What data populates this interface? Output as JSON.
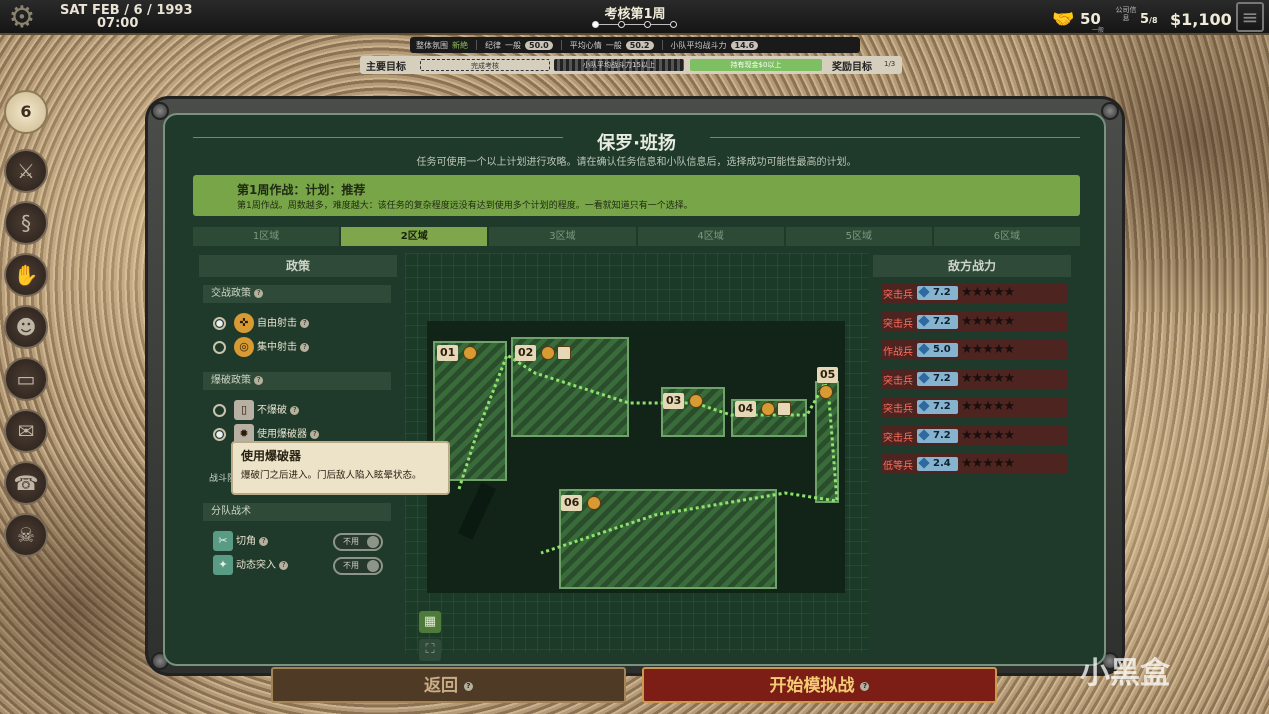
{
  "topbar": {
    "day": "SAT",
    "date": "FEB / 6 / 1993",
    "time": "07:00",
    "week_title": "考核第1周",
    "reputation": "50",
    "reputation_sub": "一般",
    "hr": "5",
    "hr_sub": "/8",
    "hr_icon_text": "公司信息",
    "money": "$1,100"
  },
  "stats": {
    "atmosphere_label": "整体氛围",
    "atmosphere_value": "新絶",
    "discipline_label": "纪律",
    "discipline_level": "一般",
    "discipline_value": "50.0",
    "mood_label": "平均心情",
    "mood_level": "一般",
    "mood_value": "50.2",
    "power_label": "小队平均战斗力",
    "power_value": "14.6"
  },
  "goals": {
    "main_label": "主要目标",
    "seg1": "完成考核",
    "seg2": "小队平均战斗力15以上",
    "seg3": "持有现金$0以上",
    "bonus_label": "奖励目标",
    "bonus_count": "1/3"
  },
  "leftbar": {
    "calendar_value": "6"
  },
  "panel": {
    "title": "保罗·班扬",
    "subtitle": "任务可使用一个以上计划进行攻略。请在确认任务信息和小队信息后，选择成功可能性最高的计划。",
    "plan_title": "第1周作战：计划：推荐",
    "plan_desc": "第1周作战。周数越多，难度越大：该任务的复杂程度远没有达到使用多个计划的程度。一看就知道只有一个选择。"
  },
  "tabs": [
    "1区域",
    "2区域",
    "3区域",
    "4区域",
    "5区域",
    "6区域"
  ],
  "policy": {
    "header": "政策",
    "engage_label": "交战政策",
    "free_fire": "自由射击",
    "focus_fire": "集中射击",
    "breach_label": "爆破政策",
    "no_breach": "不爆破",
    "use_breacher": "使用爆破器",
    "squad_label": "战斗队形",
    "split_label": "分队战术",
    "pie": "切角",
    "dynamic": "动态突入",
    "toggle_off": "不用"
  },
  "tooltip": {
    "title": "使用爆破器",
    "desc": "爆破门之后进入。门后敌人陷入眩晕状态。"
  },
  "map": {
    "rooms": [
      "01",
      "02",
      "03",
      "04",
      "05",
      "06"
    ]
  },
  "enemy": {
    "header": "敌方战力",
    "list": [
      {
        "name": "突击兵",
        "power": "7.2"
      },
      {
        "name": "突击兵",
        "power": "7.2"
      },
      {
        "name": "作战兵",
        "power": "5.0"
      },
      {
        "name": "突击兵",
        "power": "7.2"
      },
      {
        "name": "突击兵",
        "power": "7.2"
      },
      {
        "name": "突击兵",
        "power": "7.2"
      },
      {
        "name": "低等兵",
        "power": "2.4"
      }
    ]
  },
  "buttons": {
    "back": "返回",
    "start": "开始模拟战"
  },
  "watermark": "小黑盒"
}
